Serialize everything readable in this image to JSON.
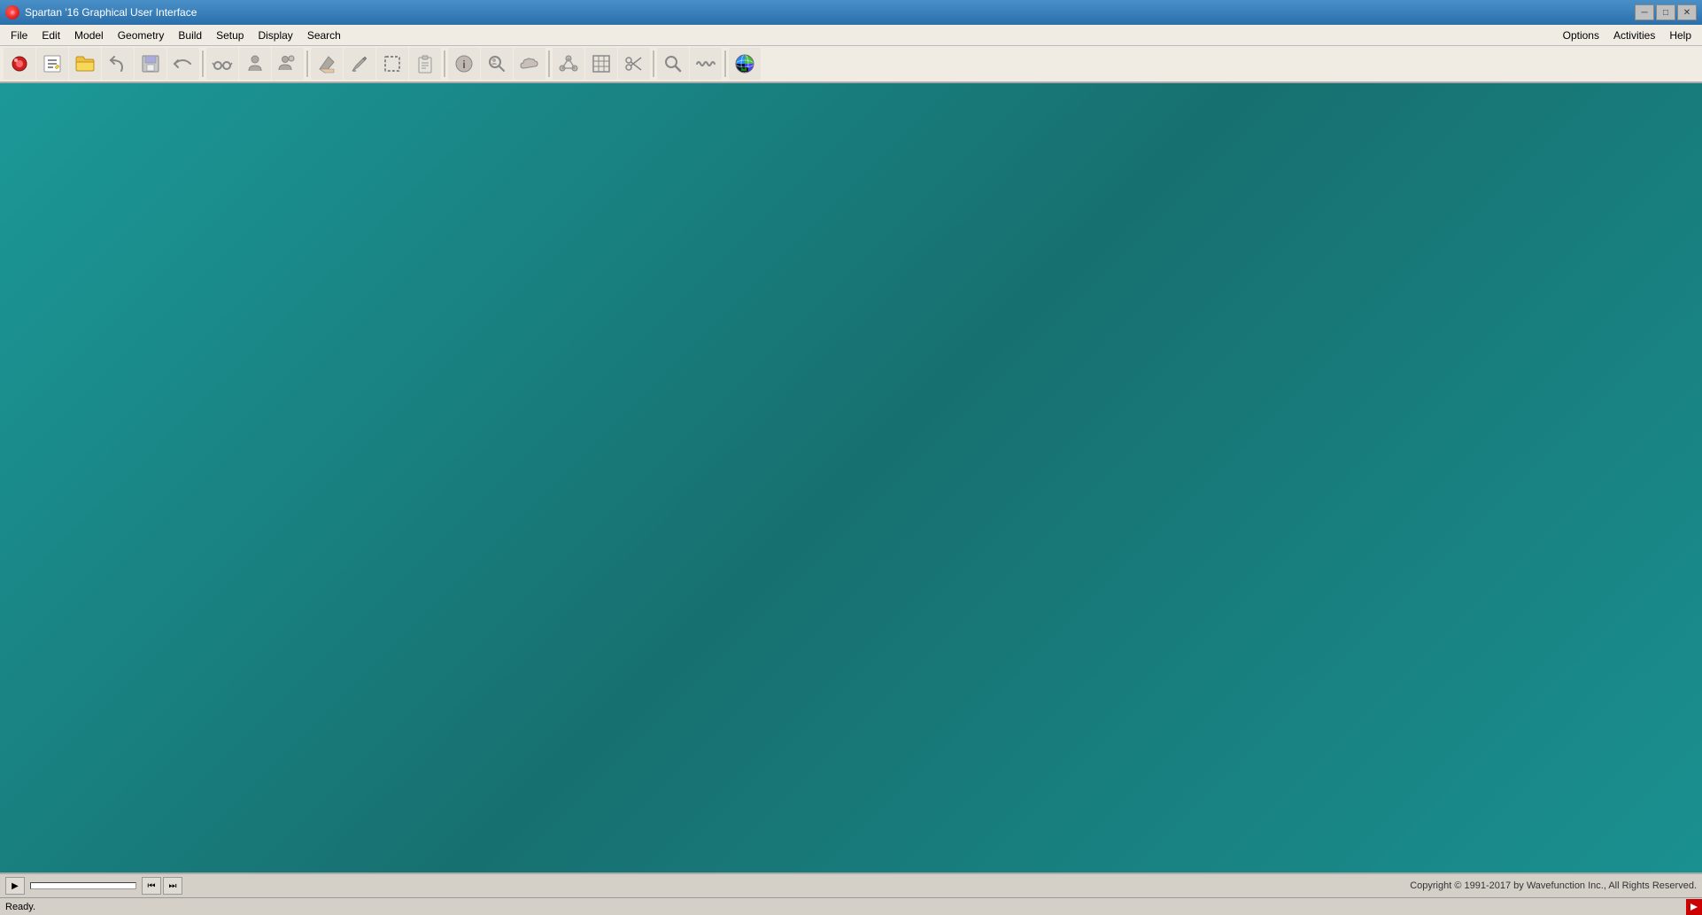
{
  "titleBar": {
    "title": "Spartan '16 Graphical User Interface",
    "minBtn": "─",
    "maxBtn": "□",
    "closeBtn": "✕"
  },
  "menuBar": {
    "items": [
      {
        "id": "file",
        "label": "File"
      },
      {
        "id": "edit",
        "label": "Edit"
      },
      {
        "id": "model",
        "label": "Model"
      },
      {
        "id": "geometry",
        "label": "Geometry"
      },
      {
        "id": "build",
        "label": "Build"
      },
      {
        "id": "setup",
        "label": "Setup"
      },
      {
        "id": "display",
        "label": "Display"
      },
      {
        "id": "search",
        "label": "Search"
      }
    ],
    "rightItems": [
      {
        "id": "options",
        "label": "Options"
      },
      {
        "id": "activities",
        "label": "Activities"
      },
      {
        "id": "help",
        "label": "Help"
      }
    ]
  },
  "toolbar": {
    "buttons": [
      {
        "id": "new",
        "icon": "new-doc-icon",
        "symbol": "📄"
      },
      {
        "id": "open",
        "icon": "open-icon",
        "symbol": "✏️"
      },
      {
        "id": "folder",
        "icon": "folder-icon",
        "symbol": "📁"
      },
      {
        "id": "back",
        "icon": "back-icon",
        "symbol": "↩"
      },
      {
        "id": "save",
        "icon": "save-icon",
        "symbol": "💾"
      },
      {
        "id": "undo",
        "icon": "undo-icon",
        "symbol": "↺"
      },
      {
        "id": "glasses",
        "icon": "glasses-icon",
        "symbol": "👓"
      },
      {
        "id": "person1",
        "icon": "person1-icon",
        "symbol": "👤"
      },
      {
        "id": "person2",
        "icon": "person2-icon",
        "symbol": "👥"
      },
      {
        "id": "pencil",
        "icon": "pencil-icon",
        "symbol": "✏"
      },
      {
        "id": "pen",
        "icon": "pen-icon",
        "symbol": "🖊"
      },
      {
        "id": "select",
        "icon": "select-icon",
        "symbol": "⬜"
      },
      {
        "id": "clipboard",
        "icon": "clipboard-icon",
        "symbol": "📋"
      },
      {
        "id": "info",
        "icon": "info-icon",
        "symbol": "ℹ"
      },
      {
        "id": "eyeglasses2",
        "icon": "eyeglasses2-icon",
        "symbol": "🔍"
      },
      {
        "id": "cloud",
        "icon": "cloud-icon",
        "symbol": "☁"
      },
      {
        "id": "molecule",
        "icon": "molecule-icon",
        "symbol": "⚗"
      },
      {
        "id": "wires",
        "icon": "wires-icon",
        "symbol": "┼"
      },
      {
        "id": "scissors",
        "icon": "scissors-icon",
        "symbol": "✂"
      },
      {
        "id": "search2",
        "icon": "search2-icon",
        "symbol": "🔎"
      },
      {
        "id": "wave",
        "icon": "wave-icon",
        "symbol": "〰"
      },
      {
        "id": "globe",
        "icon": "globe-icon",
        "symbol": "🌐"
      }
    ]
  },
  "bottomBar": {
    "playBtn": "▶",
    "prevBtn": "⏮",
    "nextBtn": "⏭",
    "copyright": "Copyright © 1991-2017 by Wavefunction Inc., All Rights Reserved."
  },
  "statusBar": {
    "status": "Ready."
  },
  "canvas": {
    "bgColor": "#1a9090"
  }
}
